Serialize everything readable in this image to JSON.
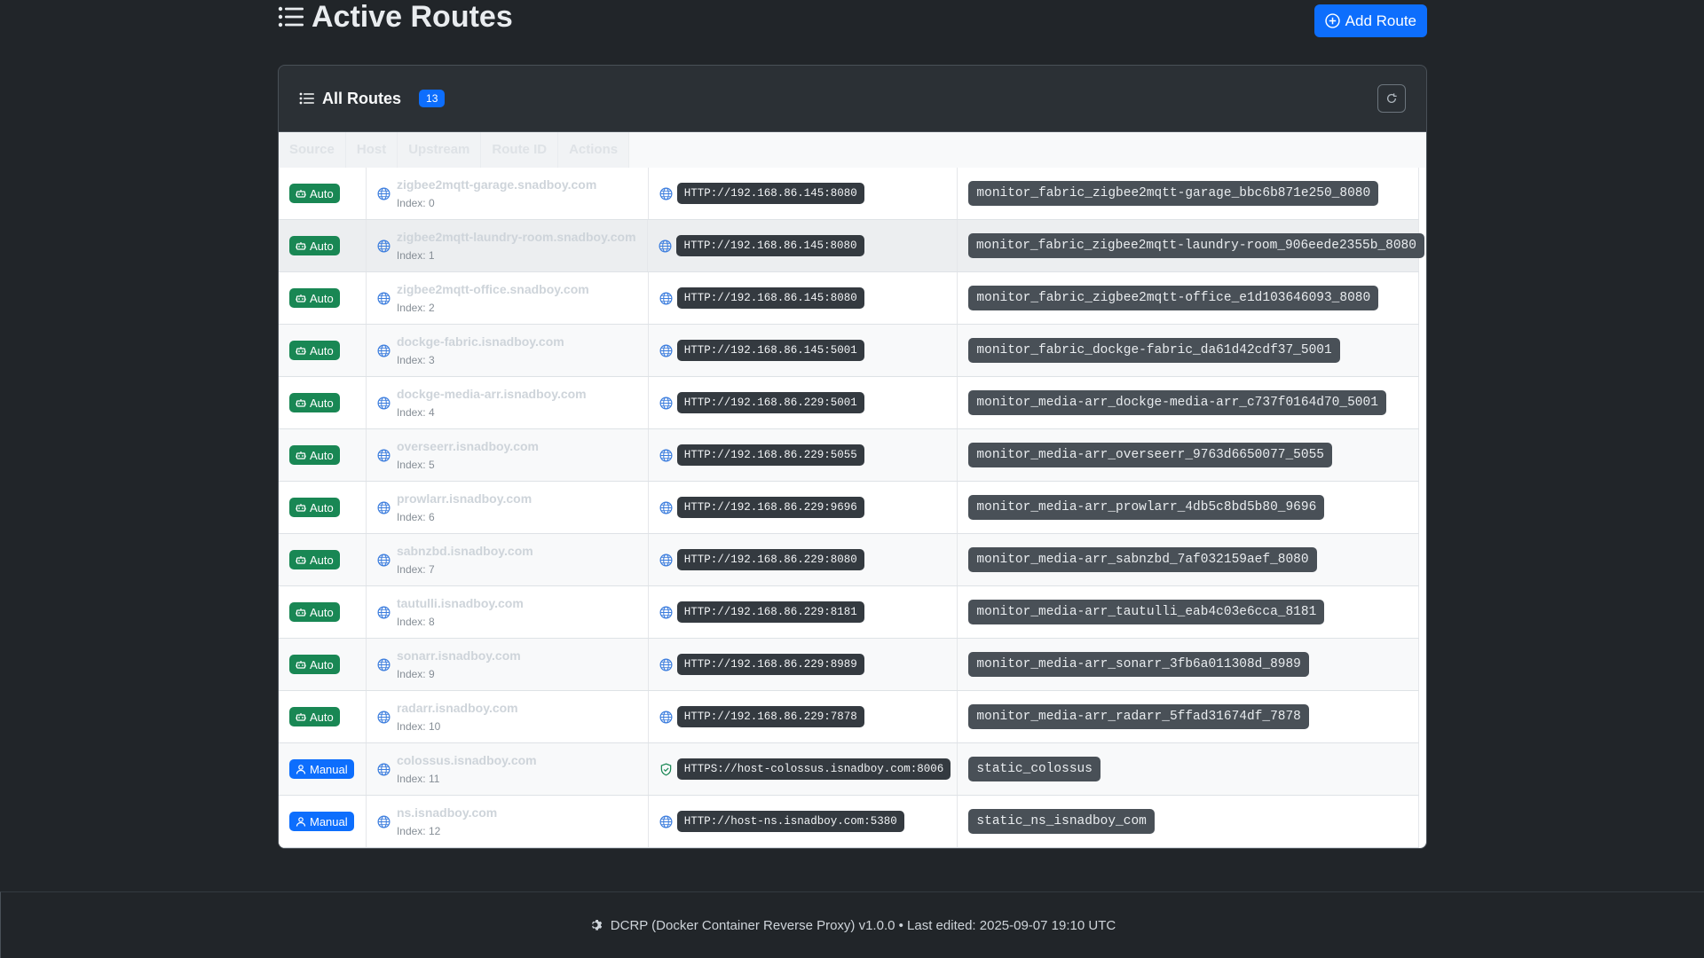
{
  "header": {
    "title": "Active Routes",
    "add_button_label": "Add Route"
  },
  "card": {
    "title": "All Routes",
    "count": "13"
  },
  "table": {
    "columns": [
      "Source",
      "Host",
      "Upstream",
      "Route ID",
      "Actions"
    ],
    "rows": [
      {
        "source": "Auto",
        "host": "zigbee2mqtt-garage.snadboy.com",
        "index": "Index: 0",
        "upstream": "HTTP://192.168.86.145:8080",
        "route_id": "monitor_fabric_zigbee2mqtt-garage_bbc6b871e250_8080"
      },
      {
        "source": "Auto",
        "host": "zigbee2mqtt-laundry-room.snadboy.com",
        "index": "Index: 1",
        "upstream": "HTTP://192.168.86.145:8080",
        "route_id": "monitor_fabric_zigbee2mqtt-laundry-room_906eede2355b_8080"
      },
      {
        "source": "Auto",
        "host": "zigbee2mqtt-office.snadboy.com",
        "index": "Index: 2",
        "upstream": "HTTP://192.168.86.145:8080",
        "route_id": "monitor_fabric_zigbee2mqtt-office_e1d103646093_8080"
      },
      {
        "source": "Auto",
        "host": "dockge-fabric.isnadboy.com",
        "index": "Index: 3",
        "upstream": "HTTP://192.168.86.145:5001",
        "route_id": "monitor_fabric_dockge-fabric_da61d42cdf37_5001"
      },
      {
        "source": "Auto",
        "host": "dockge-media-arr.isnadboy.com",
        "index": "Index: 4",
        "upstream": "HTTP://192.168.86.229:5001",
        "route_id": "monitor_media-arr_dockge-media-arr_c737f0164d70_5001"
      },
      {
        "source": "Auto",
        "host": "overseerr.isnadboy.com",
        "index": "Index: 5",
        "upstream": "HTTP://192.168.86.229:5055",
        "route_id": "monitor_media-arr_overseerr_9763d6650077_5055"
      },
      {
        "source": "Auto",
        "host": "prowlarr.isnadboy.com",
        "index": "Index: 6",
        "upstream": "HTTP://192.168.86.229:9696",
        "route_id": "monitor_media-arr_prowlarr_4db5c8bd5b80_9696"
      },
      {
        "source": "Auto",
        "host": "sabnzbd.isnadboy.com",
        "index": "Index: 7",
        "upstream": "HTTP://192.168.86.229:8080",
        "route_id": "monitor_media-arr_sabnzbd_7af032159aef_8080"
      },
      {
        "source": "Auto",
        "host": "tautulli.isnadboy.com",
        "index": "Index: 8",
        "upstream": "HTTP://192.168.86.229:8181",
        "route_id": "monitor_media-arr_tautulli_eab4c03e6cca_8181"
      },
      {
        "source": "Auto",
        "host": "sonarr.isnadboy.com",
        "index": "Index: 9",
        "upstream": "HTTP://192.168.86.229:8989",
        "route_id": "monitor_media-arr_sonarr_3fb6a011308d_8989"
      },
      {
        "source": "Auto",
        "host": "radarr.isnadboy.com",
        "index": "Index: 10",
        "upstream": "HTTP://192.168.86.229:7878",
        "route_id": "monitor_media-arr_radarr_5ffad31674df_7878"
      },
      {
        "source": "Manual",
        "host": "colossus.isnadboy.com",
        "index": "Index: 11",
        "upstream": "HTTPS://host-colossus.isnadboy.com:8006",
        "route_id": "static_colossus"
      },
      {
        "source": "Manual",
        "host": "ns.isnadboy.com",
        "index": "Index: 12",
        "upstream": "HTTP://host-ns.isnadboy.com:5380",
        "route_id": "static_ns_isnadboy_com"
      }
    ]
  },
  "footer": {
    "text": "DCRP (Docker Container Reverse Proxy) v1.0.0 • Last edited: 2025-09-07 19:10 UTC"
  },
  "colors": {
    "accent": "#0d6efd",
    "auto_badge": "#198754",
    "manual_badge": "#0d6efd",
    "background": "#212529"
  },
  "icons": {
    "title": "list-icon",
    "add": "plus-circle-icon",
    "refresh": "refresh-icon",
    "auto": "robot-icon",
    "manual": "person-icon",
    "globe": "globe-icon",
    "secure": "shield-icon",
    "footer": "gear-icon"
  }
}
